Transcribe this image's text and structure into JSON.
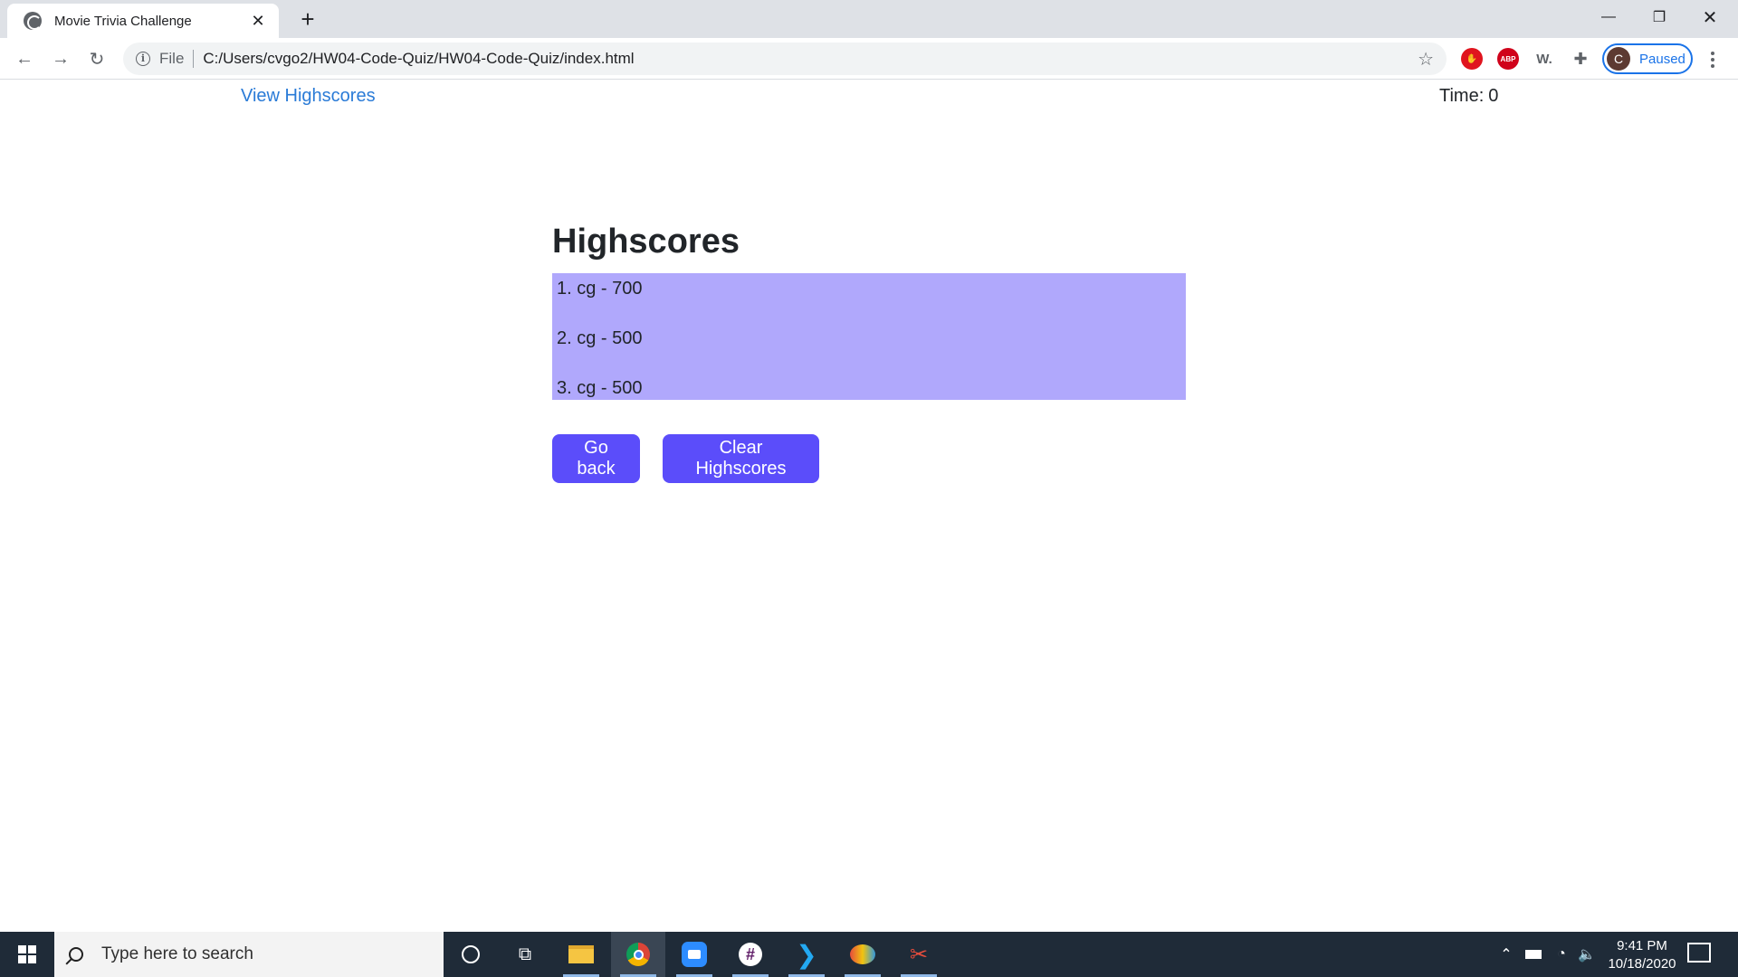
{
  "browser": {
    "tab_title": "Movie Trivia Challenge",
    "url_scheme": "File",
    "url": "C:/Users/cvgo2/HW04-Code-Quiz/HW04-Code-Quiz/index.html",
    "profile_initial": "C",
    "profile_status": "Paused",
    "extensions": [
      "adblock-stop",
      "adblock-plus",
      "w-extension",
      "extensions-puzzle"
    ]
  },
  "page": {
    "view_highscores": "View Highscores",
    "timer_label": "Time:",
    "timer_value": "0",
    "title": "Highscores",
    "scores": [
      "1. cg - 700",
      "2. cg - 500",
      "3. cg - 500"
    ],
    "go_back_label": "Go back",
    "clear_label": "Clear Highscores"
  },
  "taskbar": {
    "search_placeholder": "Type here to search",
    "time": "9:41 PM",
    "date": "10/18/2020",
    "apps": [
      "cortana",
      "task-view",
      "file-explorer",
      "chrome",
      "zoom",
      "slack",
      "vscode",
      "paint",
      "snip"
    ]
  },
  "colors": {
    "accent_button": "#5b4dfa",
    "list_background": "#b0a8fc",
    "link": "#2a7bd7"
  }
}
